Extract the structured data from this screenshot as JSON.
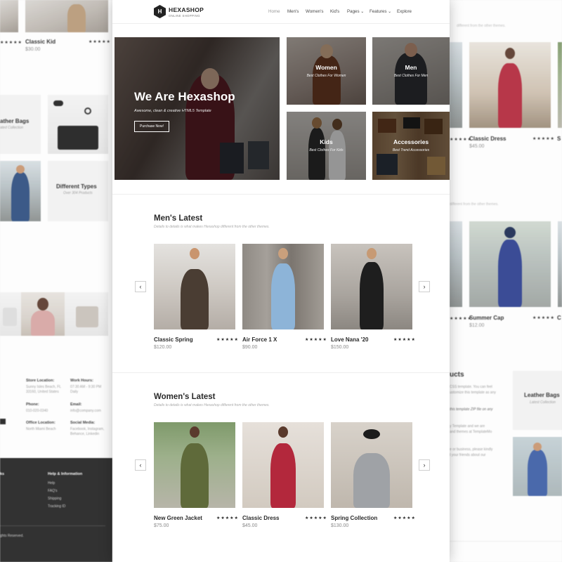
{
  "colors": {
    "dark": "#2a2a2a",
    "footer": "#232323",
    "muted": "#8a8a8a"
  },
  "left_page": {
    "top_product": {
      "title": "Classic Kid",
      "price": "$30.00",
      "stars": "★★★★★"
    },
    "left_stars": "★★★★★",
    "leather": {
      "title": "ather Bags",
      "sub": "ated Collection"
    },
    "types": {
      "title": "Different Types",
      "sub": "Over 304 Products"
    },
    "contact": [
      {
        "label": "Store Location:",
        "value": "Sunny Isles Beach, FL 33160, United States"
      },
      {
        "label": "Work Hours:",
        "value": "07:30 AM - 9:30 PM Daily"
      },
      {
        "label": "Phone:",
        "value": "010-020-0340"
      },
      {
        "label": "Email:",
        "value": "info@company.com"
      },
      {
        "label": "Office Location:",
        "value": "North Miami Beach"
      },
      {
        "label": "Social Media:",
        "value": "Facebook, Instagram, Behance, Linkedin"
      }
    ],
    "footer": {
      "col_a": "ks",
      "help_title": "Help & Information",
      "help_links": [
        "Help",
        "FAQ's",
        "Shipping",
        "Tracking ID"
      ],
      "copyright": "ghts Reserved."
    }
  },
  "header": {
    "logo_initial": "H",
    "logo_name": "HEXASHOP",
    "logo_tagline": "ONLINE SHOPPING",
    "nav": [
      {
        "label": "Home"
      },
      {
        "label": "Men's"
      },
      {
        "label": "Women's"
      },
      {
        "label": "Kid's"
      },
      {
        "label": "Pages ⌄"
      },
      {
        "label": "Features ⌄"
      },
      {
        "label": "Explore"
      }
    ]
  },
  "hero": {
    "title": "We Are Hexashop",
    "subtitle": "Awesome, clean & creative HTML5 Template",
    "button": "Purchase Now!"
  },
  "categories": [
    {
      "title": "Women",
      "sub": "Best Clothes For Women"
    },
    {
      "title": "Men",
      "sub": "Best Clothes For Men"
    },
    {
      "title": "Kids",
      "sub": "Best Clothes For Kids"
    },
    {
      "title": "Accessories",
      "sub": "Best Trend Accessories"
    }
  ],
  "mens": {
    "title": "Men's Latest",
    "sub": "Details to details is what makes Hexashop different from the other themes.",
    "prev": "‹",
    "next": "›",
    "products": [
      {
        "title": "Classic Spring",
        "price": "$120.00",
        "stars": "★★★★★"
      },
      {
        "title": "Air Force 1 X",
        "price": "$90.00",
        "stars": "★★★★★"
      },
      {
        "title": "Love Nana '20",
        "price": "$150.00",
        "stars": "★★★★★"
      }
    ]
  },
  "womens": {
    "title": "Women's Latest",
    "sub": "Details to details is what makes Hexashop different from the other themes.",
    "prev": "‹",
    "next": "›",
    "products": [
      {
        "title": "New Green Jacket",
        "price": "$75.00",
        "stars": "★★★★★"
      },
      {
        "title": "Classic Dress",
        "price": "$45.00",
        "stars": "★★★★★"
      },
      {
        "title": "Spring Collection",
        "price": "$130.00",
        "stars": "★★★★★"
      }
    ]
  },
  "right_page": {
    "label1": "different from the other themes.",
    "product1": {
      "title": "Classic Dress",
      "price": "$45.00",
      "stars": "★★★★★"
    },
    "label2": "different from the other themes.",
    "product2": {
      "title": "Summer Cap",
      "price": "$12.00",
      "stars": "★★★★★"
    },
    "partial_letter_top": "S",
    "partial_letter_mid": "C",
    "ucts_title": "ucts",
    "ucts_text": [
      "CSS template. You can feel",
      "ustomize this template as any",
      "",
      "this template ZIP file on any",
      "",
      "y Template and we are",
      "and themes at TemplateMo",
      "",
      "e or business, please kindly",
      "t your friends about our"
    ],
    "leather": {
      "title": "Leather Bags",
      "sub": "Latest Collection"
    }
  }
}
